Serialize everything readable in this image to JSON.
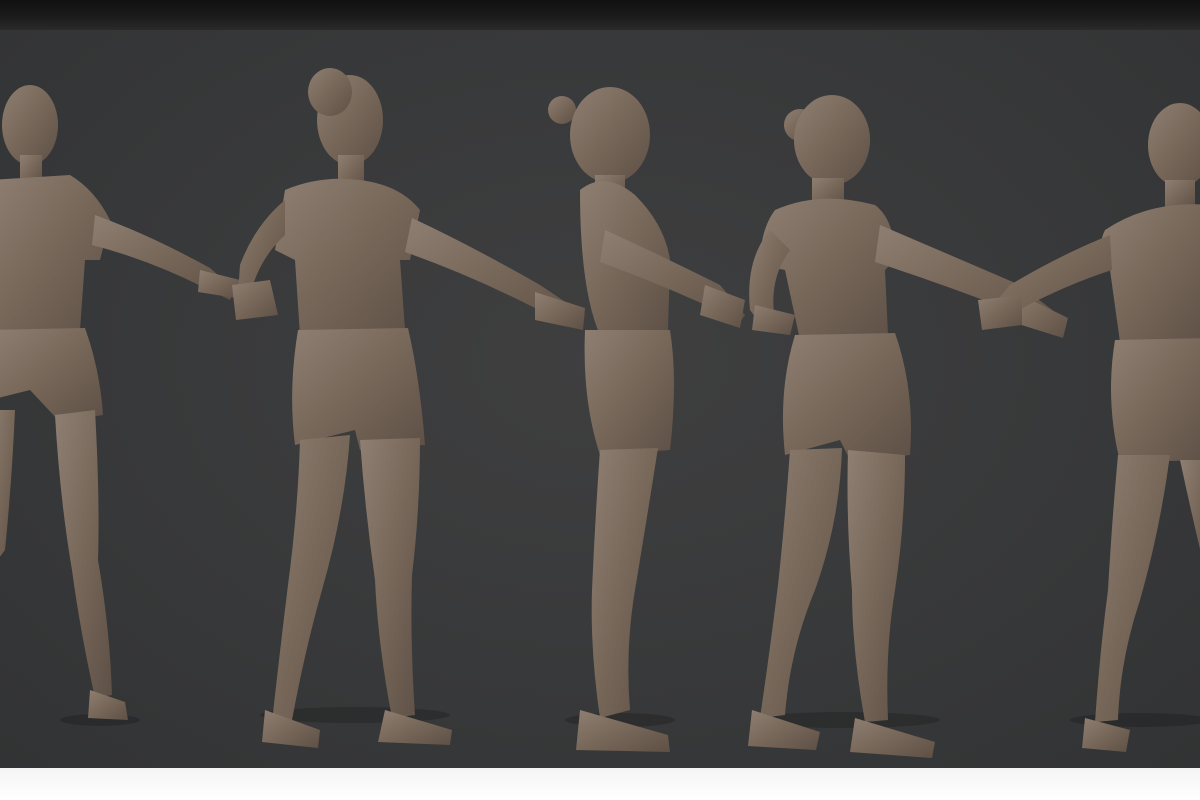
{
  "scene": {
    "background_color": "#38393a",
    "top_band_color": "#161616",
    "bottom_band_color": "#ffffff",
    "material_color": "#7a6a5d",
    "figures": [
      {
        "id": "front-view-left",
        "view": "front"
      },
      {
        "id": "three-quarter-view",
        "view": "three-quarter"
      },
      {
        "id": "side-view",
        "view": "side"
      },
      {
        "id": "back-three-quarter-view",
        "view": "back-three-quarter"
      },
      {
        "id": "back-view-right",
        "view": "back"
      }
    ]
  }
}
